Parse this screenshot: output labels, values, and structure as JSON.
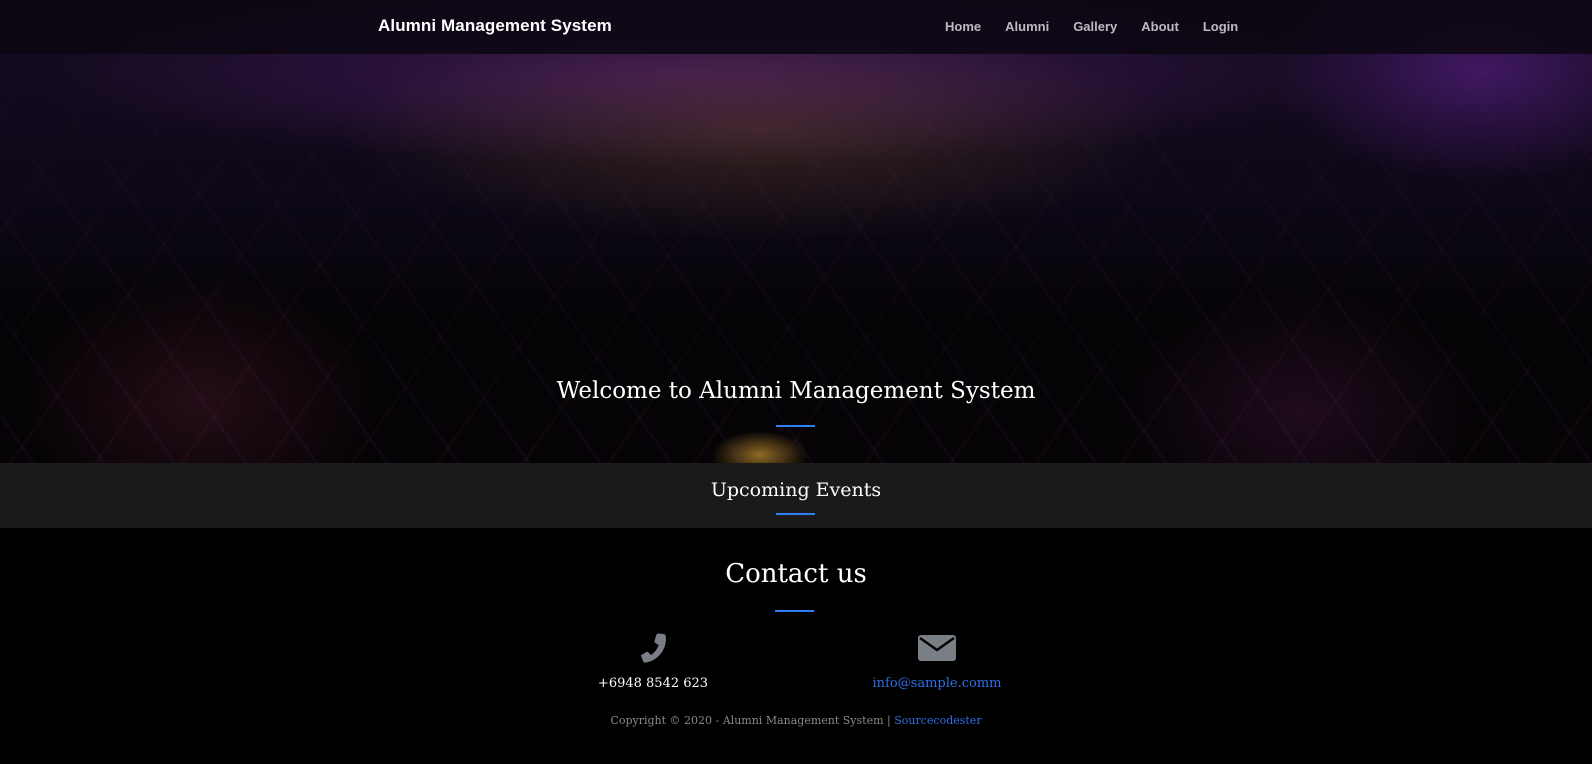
{
  "navbar": {
    "brand": "Alumni Management System",
    "links": [
      "Home",
      "Alumni",
      "Gallery",
      "About",
      "Login"
    ]
  },
  "hero": {
    "title": "Welcome to Alumni Management System"
  },
  "events": {
    "title": "Upcoming Events"
  },
  "contact": {
    "title": "Contact us",
    "phone": "+6948 8542 623",
    "email": "info@sample.comm"
  },
  "footer": {
    "copyright": "Copyright © 2020 - Alumni Management System | ",
    "credit_link": "Sourcecodester"
  },
  "colors": {
    "accent": "#2f7ef5",
    "link": "#2f6fe8",
    "events_bg": "#1a1a1a",
    "icon": "#7a7f86"
  },
  "icons": {
    "phone": "phone-icon",
    "email": "envelope-icon"
  }
}
